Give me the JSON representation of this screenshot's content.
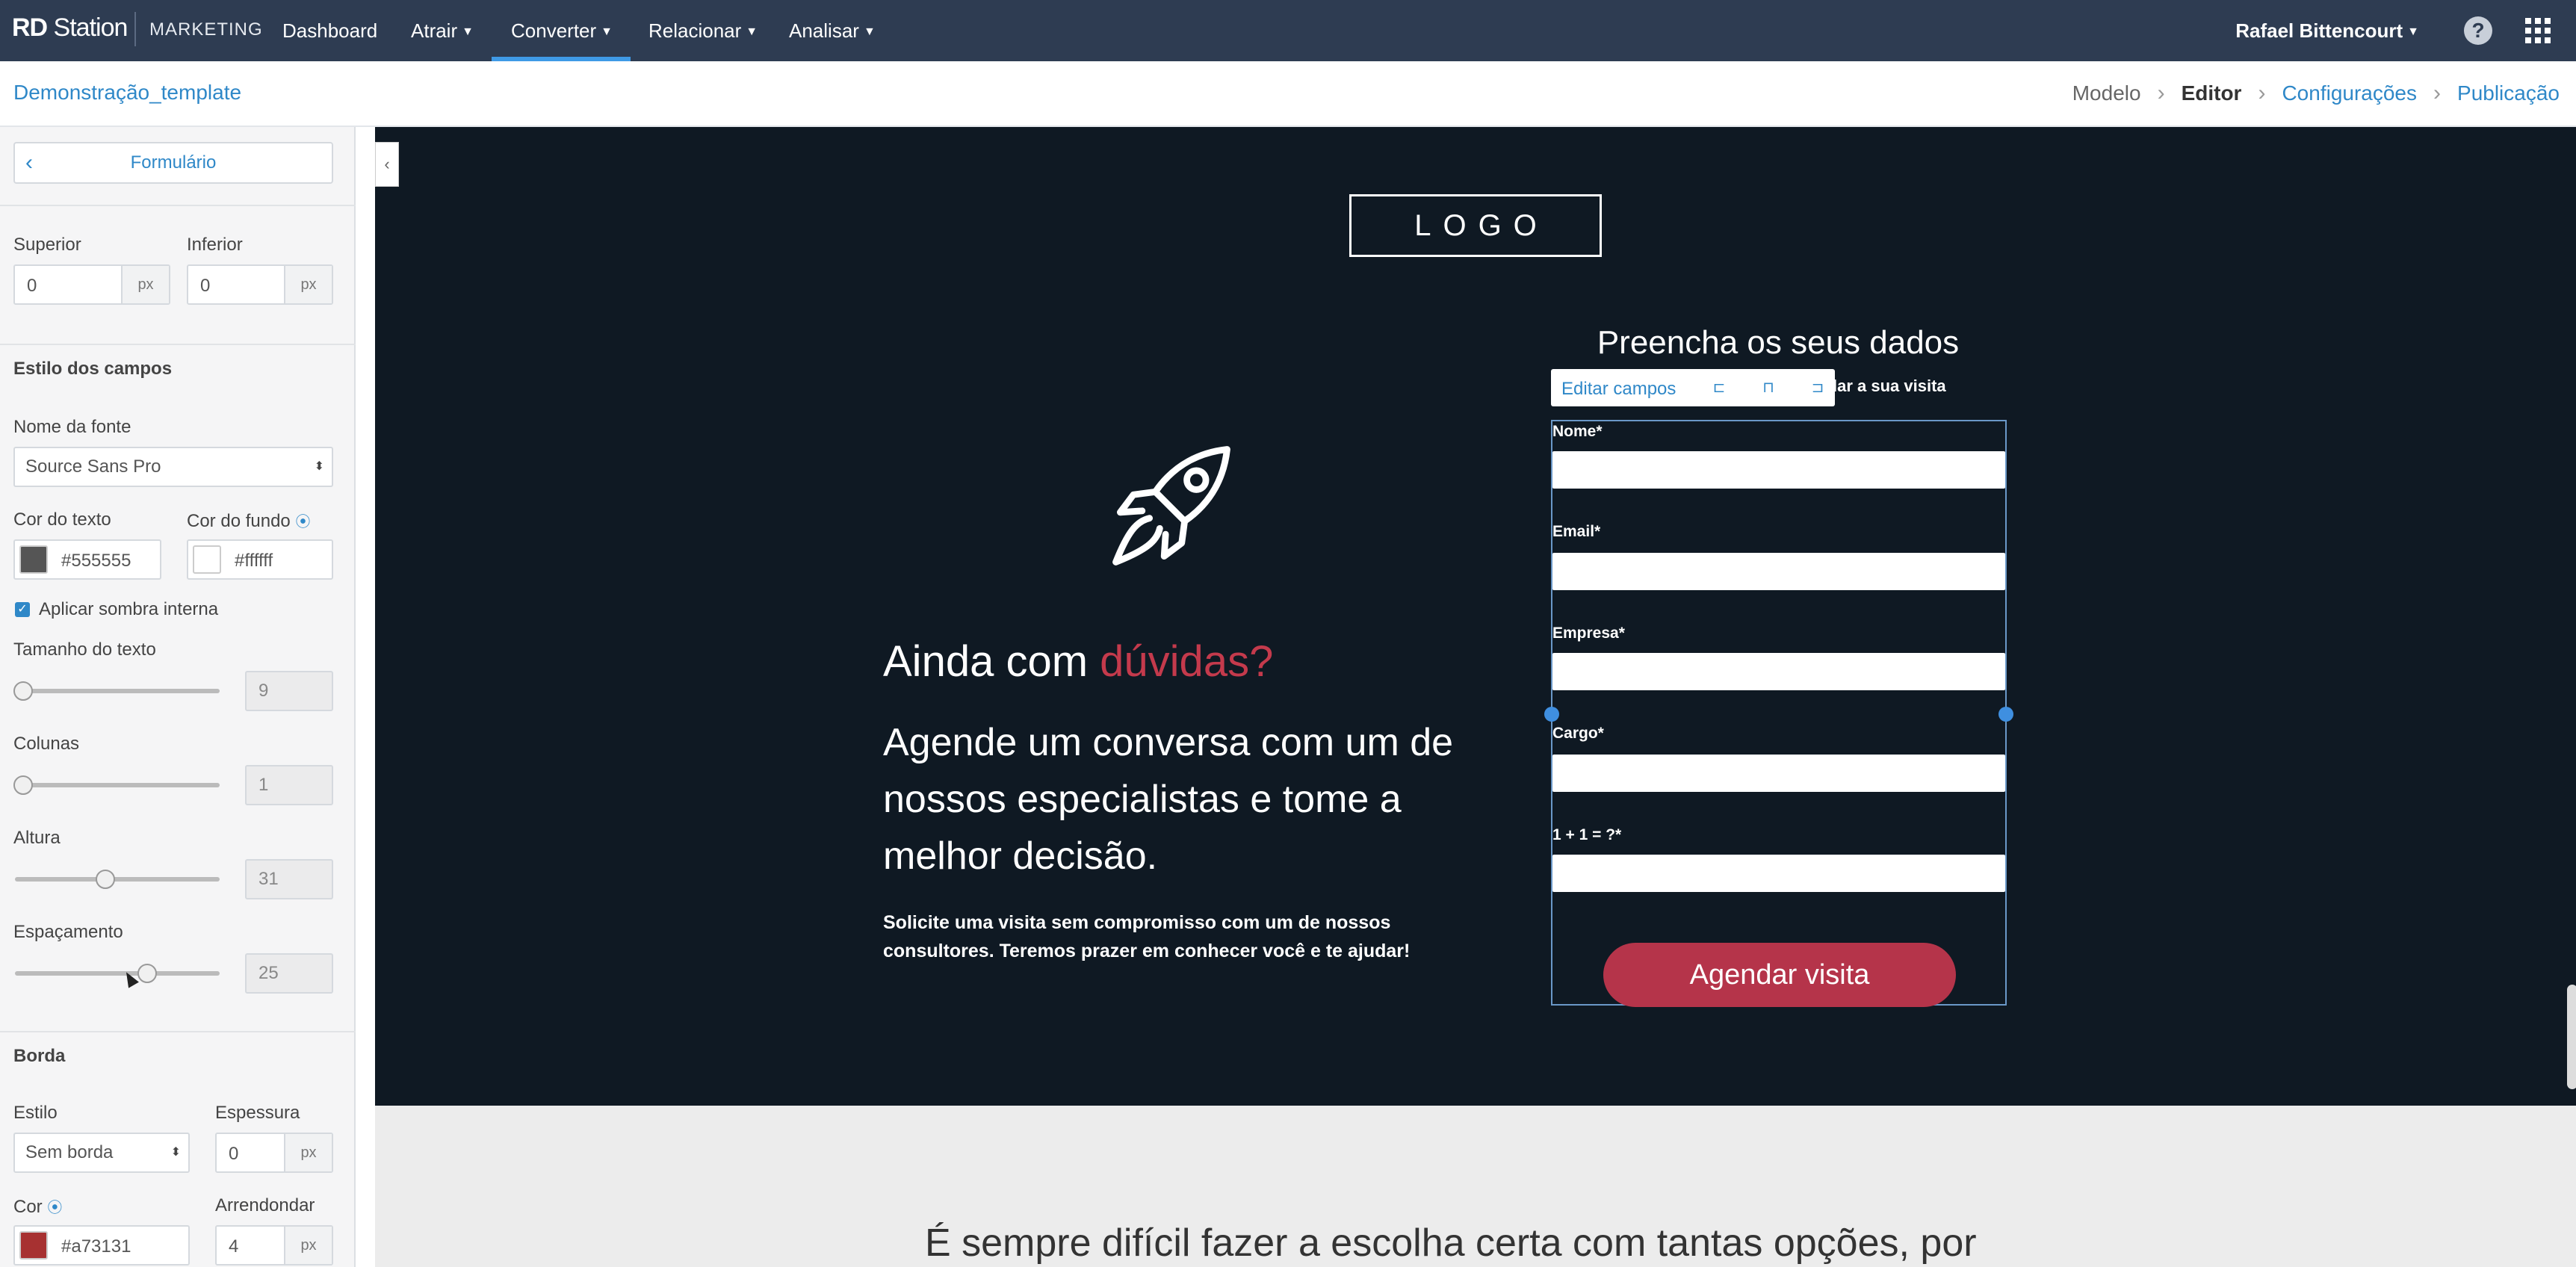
{
  "topnav": {
    "brand_main": "RD",
    "brand_station": " Station",
    "brand_sub": "MARKETING",
    "items": [
      {
        "label": "Dashboard",
        "dropdown": false
      },
      {
        "label": "Atrair",
        "dropdown": true
      },
      {
        "label": "Converter",
        "dropdown": true,
        "active": true
      },
      {
        "label": "Relacionar",
        "dropdown": true
      },
      {
        "label": "Analisar",
        "dropdown": true
      }
    ],
    "user": "Rafael Bittencourt",
    "help_glyph": "?",
    "accent_color": "#3f9ae6"
  },
  "subheader": {
    "template_name": "Demonstração_template",
    "breadcrumbs": [
      "Modelo",
      "Editor",
      "Configurações",
      "Publicação"
    ]
  },
  "sidebar": {
    "back_label": "Formulário",
    "superior_label": "Superior",
    "superior_value": "0",
    "inferior_label": "Inferior",
    "inferior_value": "0",
    "unit": "px",
    "field_style_title": "Estilo dos campos",
    "font_name_label": "Nome da fonte",
    "font_name_value": "Source Sans Pro",
    "text_color_label": "Cor do texto",
    "text_color_value": "#555555",
    "bg_color_label": "Cor do fundo",
    "bg_color_value": "#ffffff",
    "inner_shadow_label": "Aplicar sombra interna",
    "inner_shadow_checked": true,
    "text_size_label": "Tamanho do texto",
    "text_size_value": "9",
    "columns_label": "Colunas",
    "columns_value": "1",
    "height_label": "Altura",
    "height_value": "31",
    "spacing_label": "Espaçamento",
    "spacing_value": "25",
    "border_title": "Borda",
    "border_style_label": "Estilo",
    "border_style_value": "Sem borda",
    "border_thickness_label": "Espessura",
    "border_thickness_value": "0",
    "border_color_label": "Cor",
    "border_color_value": "#a73131",
    "border_round_label": "Arrendondar",
    "border_round_value": "4"
  },
  "landing": {
    "logo": "LOGO",
    "headline_prefix": "Ainda com ",
    "headline_accent": "dúvidas?",
    "subhead": "Agende um conversa com um de nossos especialistas e tome a melhor decisão.",
    "body": "Solicite uma visita sem compromisso com um de nossos consultores. Teremos prazer em conhecer você e te ajudar!",
    "form_title": "Preencha os seus dados",
    "form_subtitle_visible": "endar a sua visita",
    "edit_fields_label": "Editar campos",
    "fields": [
      "Nome*",
      "Email*",
      "Empresa*",
      "Cargo*",
      "1 + 1 = ?*"
    ],
    "submit_label": "Agendar visita",
    "accent_color": "#c43a4c",
    "button_color": "#b5344a",
    "below_text": "É sempre difícil fazer a escolha certa com tantas opções, por"
  }
}
